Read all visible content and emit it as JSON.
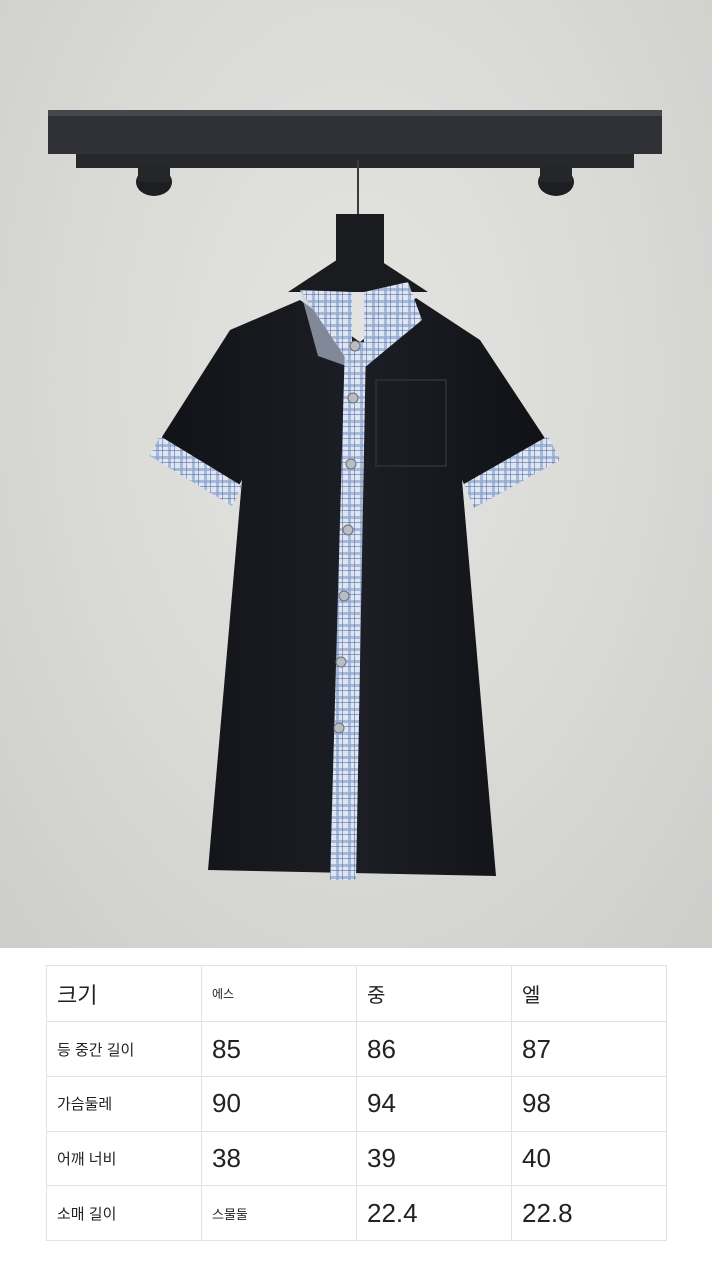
{
  "size_table": {
    "header": [
      "크기",
      "에스",
      "중",
      "엘"
    ],
    "rows": [
      {
        "label": "등 중간 길이",
        "values": [
          "85",
          "86",
          "87"
        ]
      },
      {
        "label": "가슴둘레",
        "values": [
          "90",
          "94",
          "98"
        ]
      },
      {
        "label": "어깨 너비",
        "values": [
          "38",
          "39",
          "40"
        ]
      },
      {
        "label": "소매 길이",
        "values": [
          "스물둘",
          "22.4",
          "22.8"
        ]
      }
    ]
  }
}
